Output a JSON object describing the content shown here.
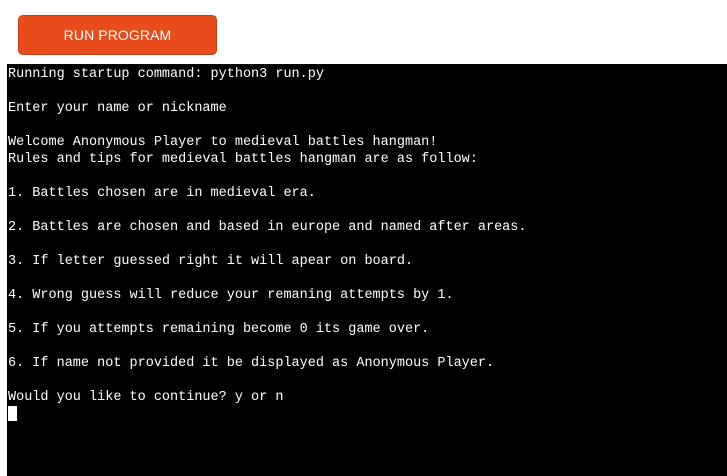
{
  "toolbar": {
    "run_label": "RUN PROGRAM"
  },
  "terminal": {
    "lines": [
      "Running startup command: python3 run.py",
      "",
      "Enter your name or nickname",
      "",
      "Welcome Anonymous Player to medieval battles hangman!",
      "Rules and tips for medieval battles hangman are as follow:",
      "",
      "1. Battles chosen are in medieval era.",
      "",
      "2. Battles are chosen and based in europe and named after areas.",
      "",
      "3. If letter guessed right it will apear on board.",
      "",
      "4. Wrong guess will reduce your remaning attempts by 1.",
      "",
      "5. If you attempts remaining become 0 its game over.",
      "",
      "6. If name not provided it be displayed as Anonymous Player.",
      "",
      "Would you like to continue? y or n"
    ]
  },
  "colors": {
    "button_bg": "#e84c1a",
    "terminal_bg": "#000000",
    "terminal_fg": "#ffffff"
  }
}
